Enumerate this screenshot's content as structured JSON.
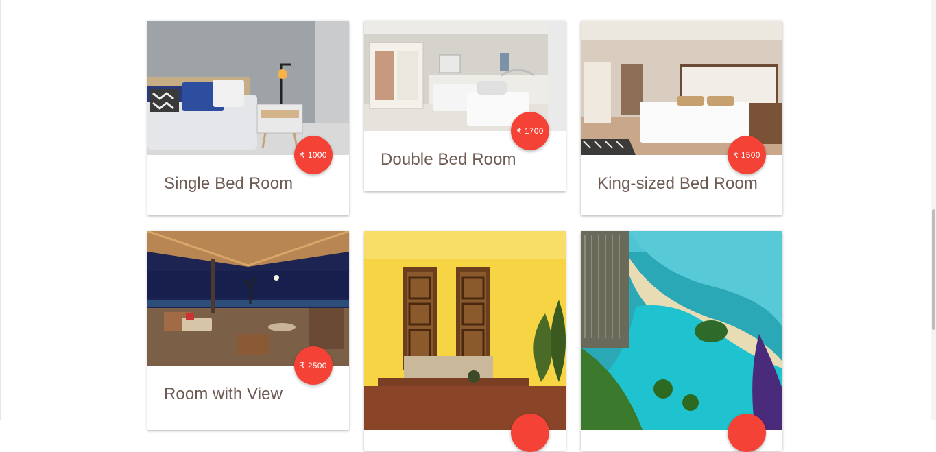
{
  "rooms": [
    {
      "title": "Single Bed Room",
      "price": "₹ 1000"
    },
    {
      "title": "Double Bed Room",
      "price": "₹ 1700"
    },
    {
      "title": "King-sized Bed Room",
      "price": "₹ 1500"
    },
    {
      "title": "Room with View",
      "price": "₹ 2500"
    },
    {
      "title": "",
      "price": ""
    },
    {
      "title": "",
      "price": ""
    }
  ],
  "colors": {
    "accent": "#f44336",
    "title_text": "#6d5a52"
  }
}
